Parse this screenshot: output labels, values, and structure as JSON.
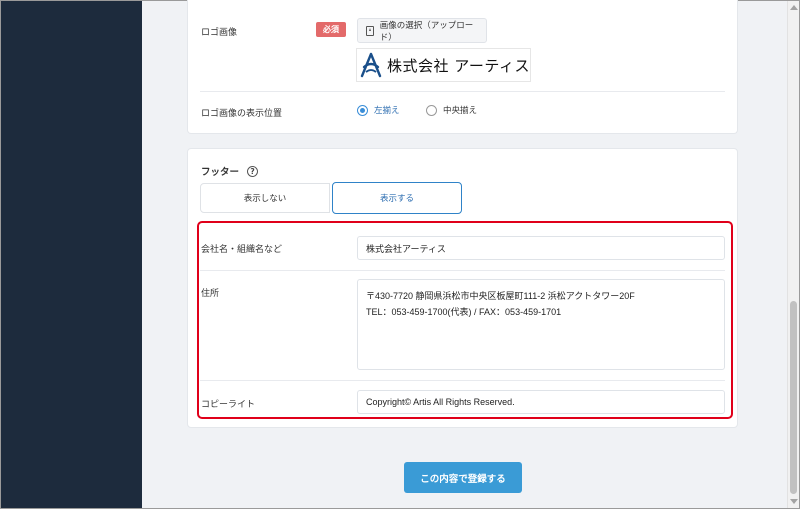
{
  "logo_section": {
    "logo_label": "ロゴ画像",
    "required_badge": "必須",
    "upload_button": "画像の選択（アップロード）",
    "logo_preview_text": "株式会社 アーティス",
    "position_label": "ロゴ画像の表示位置",
    "position_options": [
      {
        "label": "左揃え",
        "checked": true
      },
      {
        "label": "中央揃え",
        "checked": false
      }
    ]
  },
  "footer_section": {
    "title": "フッター",
    "toggle_off": "表示しない",
    "toggle_on": "表示する",
    "selected": "表示する",
    "company_label": "会社名・組織名など",
    "company_value": "株式会社アーティス",
    "address_label": "住所",
    "address_line1": "〒430-7720 静岡県浜松市中央区板屋町111-2 浜松アクトタワー20F",
    "address_line2": "TEL：053-459-1700(代表) / FAX：053-459-1701",
    "copyright_label": "コピーライト",
    "copyright_value": "Copyright© Artis All Rights Reserved."
  },
  "submit_button": "この内容で登録する",
  "colors": {
    "sidebar": "#1d2b3d",
    "accent": "#3a9bd6",
    "required": "#e36a6a",
    "highlight": "#e0001a"
  }
}
